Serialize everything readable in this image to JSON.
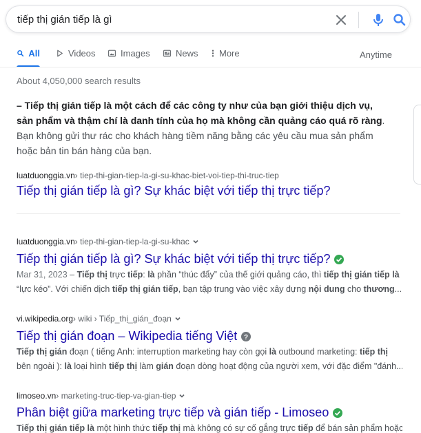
{
  "search": {
    "query": "tiếp thị gián tiếp là gì"
  },
  "tabs": [
    {
      "label": "All",
      "icon": "search-icon"
    },
    {
      "label": "Videos",
      "icon": "play-icon"
    },
    {
      "label": "Images",
      "icon": "image-icon"
    },
    {
      "label": "News",
      "icon": "newspaper-icon"
    },
    {
      "label": "More",
      "icon": "more-vert-icon"
    }
  ],
  "tools": {
    "anytime": "Anytime"
  },
  "stats": "About 4,050,000 search results",
  "featured_snippet": {
    "bold_text": "– Tiếp thị gián tiếp là một cách để các công ty như của bạn giới thiệu dịch vụ, sản phẩm và thậm chí là danh tính của họ mà không cần quảng cáo quá rõ ràng",
    "normal_text": ". Bạn không gửi thư rác cho khách hàng tiềm năng bằng các yêu cầu mua sản phẩm hoặc bản tin bán hàng của bạn.",
    "cite_domain": "luatduonggia.vn",
    "cite_path": " › tiep-thi-gian-tiep-la-gi-su-khac-biet-voi-tiep-thi-truc-tiep",
    "title": "Tiếp thị gián tiếp là gì? Sự khác biệt với tiếp thị trực tiếp?"
  },
  "results": [
    {
      "domain": "luatduonggia.vn",
      "path": " › tiep-thi-gian-tiep-la-gi-su-khac",
      "title": "Tiếp thị gián tiếp là gì? Sự khác biệt với tiếp thị trực tiếp?",
      "badge": "verified-check-icon",
      "date": "Mar 31, 2023",
      "line1": [
        {
          "t": "Mar 31, 2023 ",
          "s": "date"
        },
        {
          "t": " – ",
          "s": "n"
        },
        {
          "t": "Tiếp thị",
          "s": "b"
        },
        {
          "t": " trực ",
          "s": "n"
        },
        {
          "t": "tiếp",
          "s": "b"
        },
        {
          "t": ": ",
          "s": "n"
        },
        {
          "t": "là",
          "s": "b"
        },
        {
          "t": " phần “thúc đẩy” của thế giới quảng cáo, thì ",
          "s": "n"
        },
        {
          "t": "tiếp thị gián tiếp",
          "s": "b"
        },
        {
          "t": " ",
          "s": "n"
        },
        {
          "t": "là",
          "s": "b"
        }
      ],
      "line2": [
        {
          "t": "“lực kéo”. Với chiến dịch ",
          "s": "n"
        },
        {
          "t": "tiếp thị gián tiếp",
          "s": "b"
        },
        {
          "t": ", bạn tập trung vào việc xây dựng ",
          "s": "n"
        },
        {
          "t": "nội dung",
          "s": "b"
        },
        {
          "t": " cho ",
          "s": "n"
        },
        {
          "t": "thương",
          "s": "b"
        },
        {
          "t": "...",
          "s": "n"
        }
      ]
    },
    {
      "domain": "vi.wikipedia.org",
      "path": " › wiki › Tiếp_thị_gián_đoạn",
      "title": "Tiếp thị gián đoạn – Wikipedia tiếng Việt",
      "badge": "help-icon",
      "line1": [
        {
          "t": "Tiếp thị gián",
          "s": "b"
        },
        {
          "t": " đoạn ( tiếng Anh: interruption marketing hay còn gọi ",
          "s": "n"
        },
        {
          "t": "là",
          "s": "b"
        },
        {
          "t": " outbound marketing: ",
          "s": "n"
        },
        {
          "t": "tiếp thị",
          "s": "b"
        }
      ],
      "line2": [
        {
          "t": "bên ngoài ): ",
          "s": "n"
        },
        {
          "t": "là",
          "s": "b"
        },
        {
          "t": " loại hình ",
          "s": "n"
        },
        {
          "t": "tiếp thị",
          "s": "b"
        },
        {
          "t": " làm ",
          "s": "n"
        },
        {
          "t": "gián",
          "s": "b"
        },
        {
          "t": " đoạn dòng hoạt động của người xem, với đặc điểm \"đánh...",
          "s": "n"
        }
      ]
    },
    {
      "domain": "limoseo.vn",
      "path": " › marketing-truc-tiep-va-gian-tiep",
      "title": "Phân biệt giữa marketing trực tiếp và gián tiếp - Limoseo",
      "badge": "verified-check-icon",
      "line1": [
        {
          "t": "Tiếp thị gián tiếp là",
          "s": "b"
        },
        {
          "t": " một hình thức ",
          "s": "n"
        },
        {
          "t": "tiếp thị",
          "s": "b"
        },
        {
          "t": " mà không có sự cố gắng trực ",
          "s": "n"
        },
        {
          "t": "tiếp",
          "s": "b"
        },
        {
          "t": " để bán sản phẩm hoặc",
          "s": "n"
        }
      ]
    }
  ],
  "colors": {
    "link": "#1a0dab",
    "accent": "#1a73e8",
    "verified": "#34a853",
    "muted": "#70757a"
  }
}
